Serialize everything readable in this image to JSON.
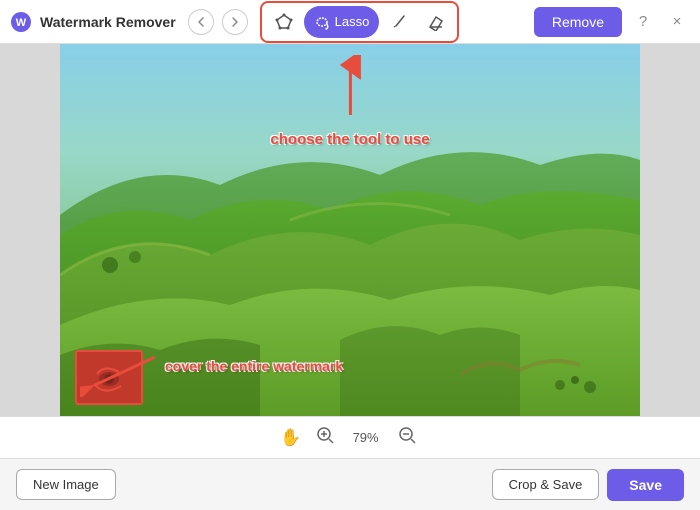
{
  "app": {
    "title": "Watermark Remover",
    "logo_unicode": "🔵"
  },
  "header": {
    "back_label": "‹",
    "forward_label": "›",
    "remove_label": "Remove",
    "help_label": "?",
    "close_label": "×"
  },
  "toolbar": {
    "tools": [
      {
        "id": "polygon",
        "label": "✦",
        "active": false
      },
      {
        "id": "lasso",
        "label": "Lasso",
        "active": true
      },
      {
        "id": "brush",
        "label": "✏",
        "active": false
      },
      {
        "id": "eraser",
        "label": "◇",
        "active": false
      }
    ],
    "hint_tool": "choose the tool to use",
    "hint_watermark": "cover the entire watermark"
  },
  "zoom": {
    "value": "79%",
    "zoom_in_label": "⊕",
    "zoom_out_label": "⊖",
    "hand_label": "✋"
  },
  "footer": {
    "new_image_label": "New Image",
    "crop_save_label": "Crop & Save",
    "save_label": "Save"
  }
}
